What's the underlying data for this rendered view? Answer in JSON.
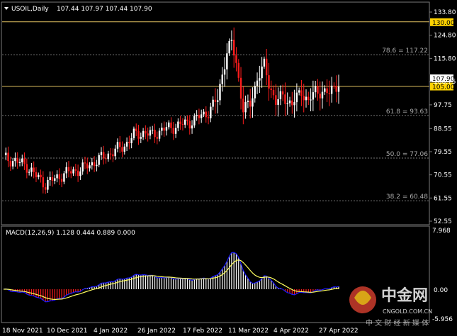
{
  "main_chart": {
    "symbol_label": "USOIL,Daily",
    "ohlc_label": "107.44 107.97 107.44 107.90",
    "price_ticks": [
      "133.80",
      "124.80",
      "115.80",
      "106.75",
      "97.75",
      "88.55",
      "79.55",
      "70.55",
      "61.55",
      "52.55"
    ],
    "horizontal_lines": [
      {
        "price": 130.0,
        "color": "#e0c060",
        "label_box": "130.00"
      },
      {
        "price": 105.0,
        "color": "#e0c060",
        "label_box": "105.00"
      }
    ],
    "fib_levels": [
      {
        "label": "78.6 = 117.22",
        "price": 117.22
      },
      {
        "label": "61.8 = 93.63",
        "price": 93.63
      },
      {
        "label": "50.0 = 77.06",
        "price": 77.06
      },
      {
        "label": "38.2 = 60.48",
        "price": 60.48
      }
    ],
    "current_price_box": "107.90",
    "colors": {
      "bull": "#ffffff",
      "bear": "#ff1c1c",
      "grid": "#333333",
      "level": "#e0c060",
      "price_box": "#ffd200"
    }
  },
  "macd_panel": {
    "label": "MACD(12,26,9) 1.128 0.444 0.889 0.000",
    "ticks": [
      "7.968",
      "0.00",
      "-5.956"
    ],
    "colors": {
      "hist_pos": "#ffffff",
      "hist_neg": "#ff1c1c",
      "macd": "#1c1cff",
      "signal": "#ffff60"
    }
  },
  "time_axis": [
    "18 Nov 2021",
    "10 Dec 2021",
    "4 Jan 2022",
    "26 Jan 2022",
    "17 Feb 2022",
    "11 Mar 2022",
    "4 Apr 2022",
    "27 Apr 2022"
  ],
  "watermark": {
    "brand": "中金网",
    "domain": "CNGOLD.COM.CN",
    "tagline": "中 文 财 经 新 媒 体"
  },
  "chart_data": {
    "type": "line",
    "title": "USOIL,Daily",
    "xlabel": "",
    "ylabel": "",
    "ylim": [
      52.55,
      133.8
    ],
    "x": [
      "18 Nov 2021",
      "10 Dec 2021",
      "4 Jan 2022",
      "26 Jan 2022",
      "17 Feb 2022",
      "11 Mar 2022",
      "4 Apr 2022",
      "27 Apr 2022"
    ],
    "series": [
      {
        "values": [
          78.5,
          71.0,
          77.5,
          86.5,
          91.5,
          112.0,
          101.0,
          105.5
        ]
      }
    ]
  }
}
